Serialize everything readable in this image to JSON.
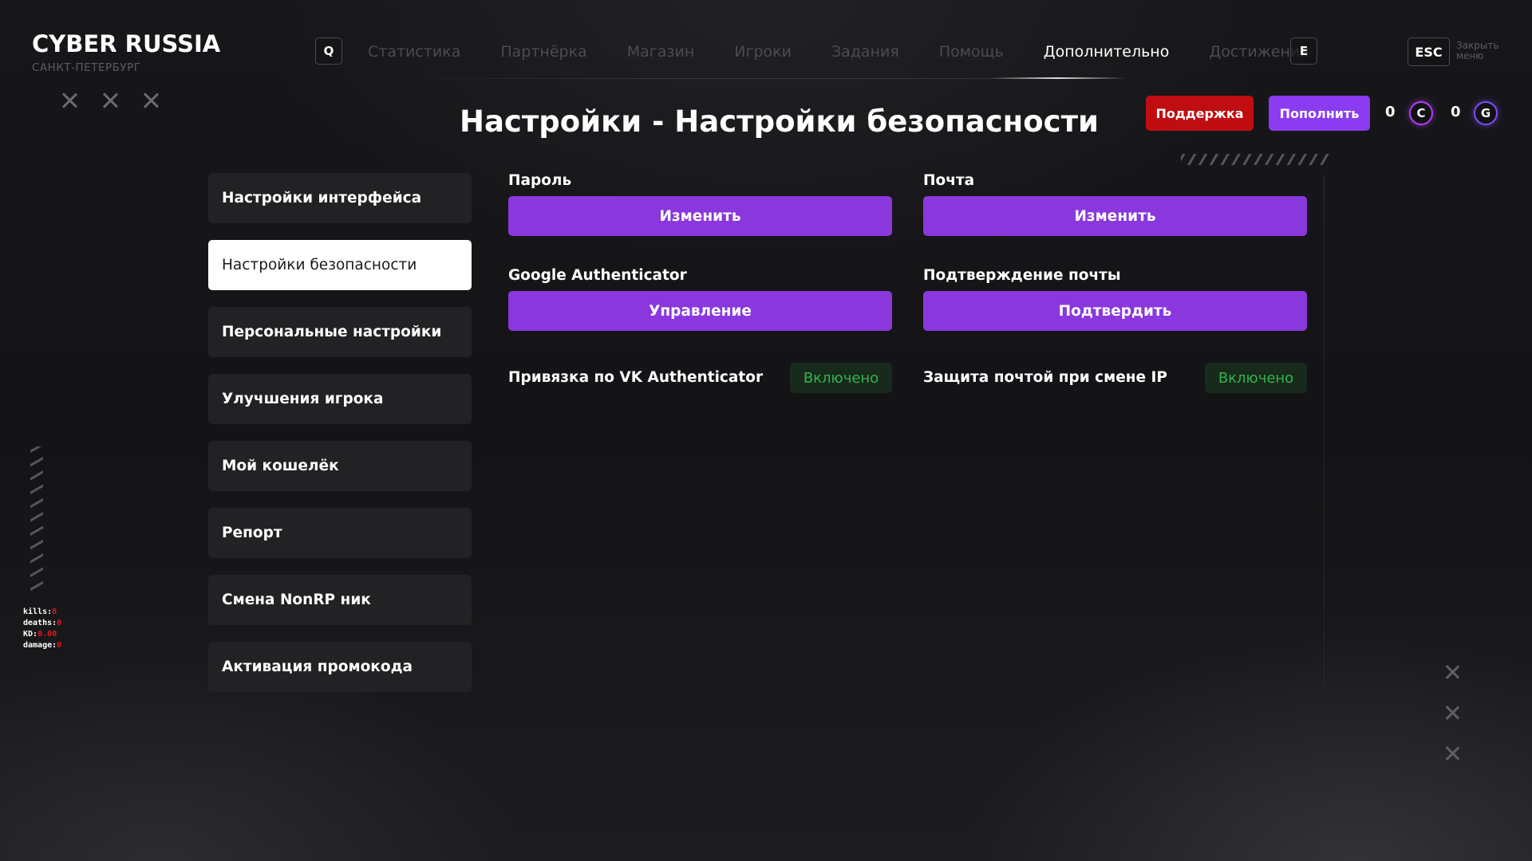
{
  "logo": {
    "title": "CYBER RUSSIA",
    "subtitle": "САНКТ-ПЕТЕРБУРГ"
  },
  "nav": {
    "prev_key": "Q",
    "next_key": "E",
    "items": [
      {
        "label": "Статистика",
        "active": false
      },
      {
        "label": "Партнёрка",
        "active": false
      },
      {
        "label": "Магазин",
        "active": false
      },
      {
        "label": "Игроки",
        "active": false
      },
      {
        "label": "Задания",
        "active": false
      },
      {
        "label": "Помощь",
        "active": false
      },
      {
        "label": "Дополнительно",
        "active": true
      },
      {
        "label": "Достижения",
        "active": false
      }
    ],
    "esc_key": "ESC",
    "esc_label": "Закрыть меню"
  },
  "header": {
    "title": "Настройки - Настройки безопасности",
    "support_label": "Поддержка",
    "topup_label": "Пополнить",
    "currency_c_value": "0",
    "currency_c_symbol": "C",
    "currency_g_value": "0",
    "currency_g_symbol": "G"
  },
  "stats": {
    "kills_label": "kills:",
    "kills_value": "0",
    "deaths_label": "deaths:",
    "deaths_value": "0",
    "kd_label": "KD:",
    "kd_value": "0.00",
    "damage_label": "damage:",
    "damage_value": "0"
  },
  "sidebar": {
    "items": [
      {
        "label": "Настройки интерфейса",
        "active": false
      },
      {
        "label": "Настройки безопасности",
        "active": true
      },
      {
        "label": "Персональные настройки",
        "active": false
      },
      {
        "label": "Улучшения игрока",
        "active": false
      },
      {
        "label": "Мой кошелёк",
        "active": false
      },
      {
        "label": "Репорт",
        "active": false
      },
      {
        "label": "Смена NonRP ник",
        "active": false
      },
      {
        "label": "Активация промокода",
        "active": false
      }
    ]
  },
  "security": {
    "password": {
      "label": "Пароль",
      "button": "Изменить"
    },
    "email": {
      "label": "Почта",
      "button": "Изменить"
    },
    "google_auth": {
      "label": "Google Authenticator",
      "button": "Управление"
    },
    "email_confirm": {
      "label": "Подтверждение почты",
      "button": "Подтвердить"
    },
    "vk_auth": {
      "label": "Привязка по VK Authenticator",
      "status": "Включено"
    },
    "ip_protection": {
      "label": "Защита почтой при смене IP",
      "status": "Включено"
    }
  },
  "colors": {
    "accent_purple": "#8a37de",
    "support_red": "#c00d12",
    "status_green": "#32b24e"
  }
}
